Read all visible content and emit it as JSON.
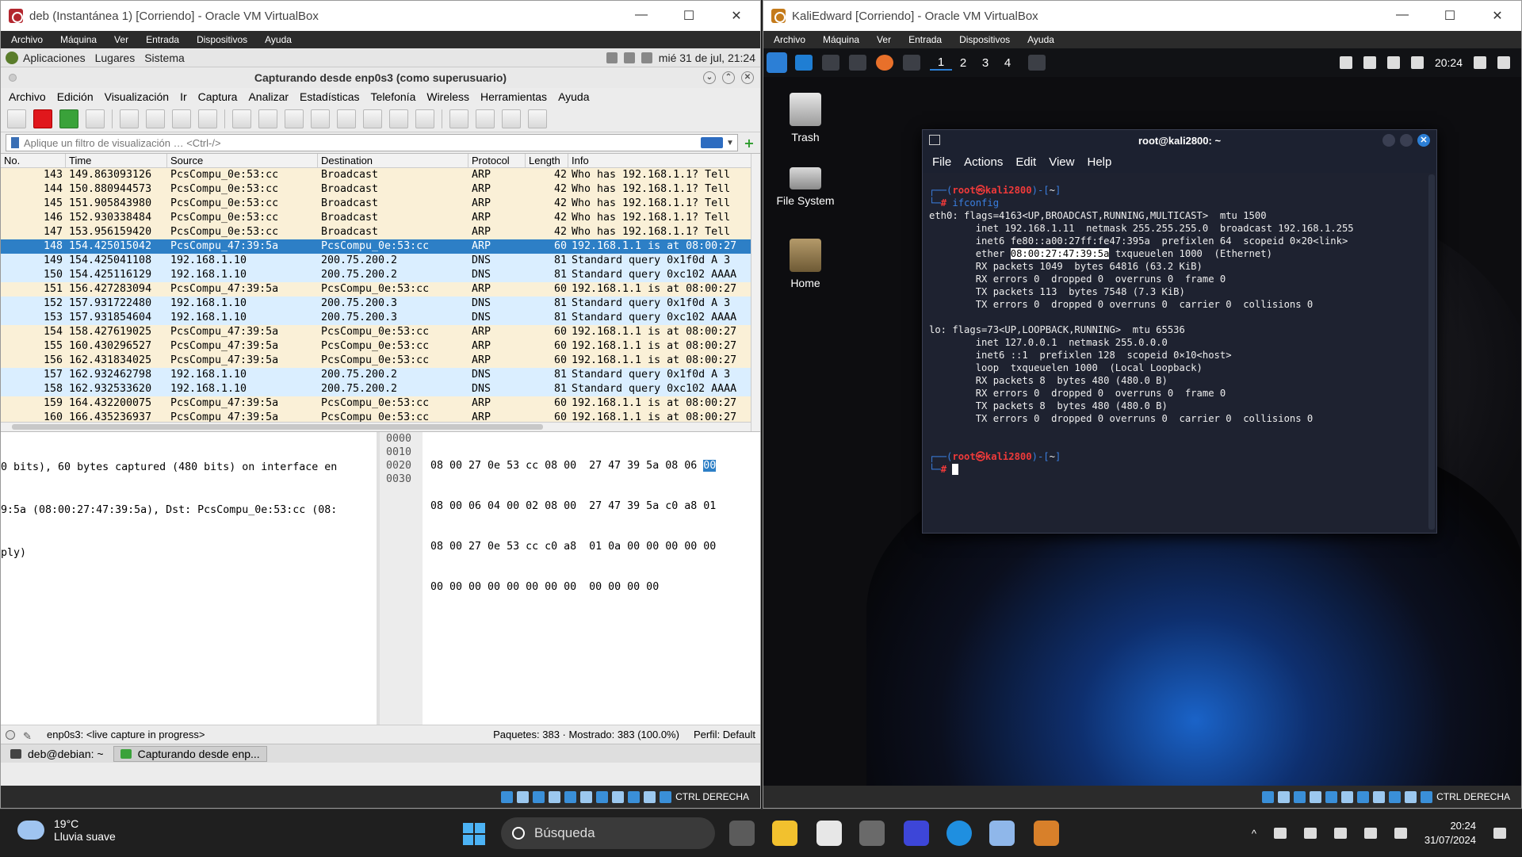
{
  "left_vm": {
    "title": "deb (Instantánea 1) [Corriendo] - Oracle VM VirtualBox",
    "menu": [
      "Archivo",
      "Máquina",
      "Ver",
      "Entrada",
      "Dispositivos",
      "Ayuda"
    ],
    "host_key": "CTRL DERECHA",
    "guest_panel": {
      "apps": "Aplicaciones",
      "places": "Lugares",
      "system": "Sistema",
      "clock": "mié 31 de jul, 21:24"
    },
    "wireshark": {
      "title": "Capturando desde enp0s3 (como superusuario)",
      "menu": [
        "Archivo",
        "Edición",
        "Visualización",
        "Ir",
        "Captura",
        "Analizar",
        "Estadísticas",
        "Telefonía",
        "Wireless",
        "Herramientas",
        "Ayuda"
      ],
      "filter_placeholder": "Aplique un filtro de visualización … <Ctrl-/>",
      "columns": [
        "No.",
        "Time",
        "Source",
        "Destination",
        "Protocol",
        "Length",
        "Info"
      ],
      "packets": [
        {
          "no": "143",
          "time": "149.863093126",
          "src": "PcsCompu_0e:53:cc",
          "dst": "Broadcast",
          "proto": "ARP",
          "len": "42",
          "info": "Who has 192.168.1.1? Tell",
          "kind": "arp"
        },
        {
          "no": "144",
          "time": "150.880944573",
          "src": "PcsCompu_0e:53:cc",
          "dst": "Broadcast",
          "proto": "ARP",
          "len": "42",
          "info": "Who has 192.168.1.1? Tell",
          "kind": "arp"
        },
        {
          "no": "145",
          "time": "151.905843980",
          "src": "PcsCompu_0e:53:cc",
          "dst": "Broadcast",
          "proto": "ARP",
          "len": "42",
          "info": "Who has 192.168.1.1? Tell",
          "kind": "arp"
        },
        {
          "no": "146",
          "time": "152.930338484",
          "src": "PcsCompu_0e:53:cc",
          "dst": "Broadcast",
          "proto": "ARP",
          "len": "42",
          "info": "Who has 192.168.1.1? Tell",
          "kind": "arp"
        },
        {
          "no": "147",
          "time": "153.956159420",
          "src": "PcsCompu_0e:53:cc",
          "dst": "Broadcast",
          "proto": "ARP",
          "len": "42",
          "info": "Who has 192.168.1.1? Tell",
          "kind": "arp"
        },
        {
          "no": "148",
          "time": "154.425015042",
          "src": "PcsCompu_47:39:5a",
          "dst": "PcsCompu_0e:53:cc",
          "proto": "ARP",
          "len": "60",
          "info": "192.168.1.1 is at 08:00:27",
          "kind": "sel"
        },
        {
          "no": "149",
          "time": "154.425041108",
          "src": "192.168.1.10",
          "dst": "200.75.200.2",
          "proto": "DNS",
          "len": "81",
          "info": "Standard query 0x1f0d A 3",
          "kind": "dns"
        },
        {
          "no": "150",
          "time": "154.425116129",
          "src": "192.168.1.10",
          "dst": "200.75.200.2",
          "proto": "DNS",
          "len": "81",
          "info": "Standard query 0xc102 AAAA",
          "kind": "dns"
        },
        {
          "no": "151",
          "time": "156.427283094",
          "src": "PcsCompu_47:39:5a",
          "dst": "PcsCompu_0e:53:cc",
          "proto": "ARP",
          "len": "60",
          "info": "192.168.1.1 is at 08:00:27",
          "kind": "arp"
        },
        {
          "no": "152",
          "time": "157.931722480",
          "src": "192.168.1.10",
          "dst": "200.75.200.3",
          "proto": "DNS",
          "len": "81",
          "info": "Standard query 0x1f0d A 3",
          "kind": "dns"
        },
        {
          "no": "153",
          "time": "157.931854604",
          "src": "192.168.1.10",
          "dst": "200.75.200.3",
          "proto": "DNS",
          "len": "81",
          "info": "Standard query 0xc102 AAAA",
          "kind": "dns"
        },
        {
          "no": "154",
          "time": "158.427619025",
          "src": "PcsCompu_47:39:5a",
          "dst": "PcsCompu_0e:53:cc",
          "proto": "ARP",
          "len": "60",
          "info": "192.168.1.1 is at 08:00:27",
          "kind": "arp"
        },
        {
          "no": "155",
          "time": "160.430296527",
          "src": "PcsCompu_47:39:5a",
          "dst": "PcsCompu_0e:53:cc",
          "proto": "ARP",
          "len": "60",
          "info": "192.168.1.1 is at 08:00:27",
          "kind": "arp"
        },
        {
          "no": "156",
          "time": "162.431834025",
          "src": "PcsCompu_47:39:5a",
          "dst": "PcsCompu_0e:53:cc",
          "proto": "ARP",
          "len": "60",
          "info": "192.168.1.1 is at 08:00:27",
          "kind": "arp"
        },
        {
          "no": "157",
          "time": "162.932462798",
          "src": "192.168.1.10",
          "dst": "200.75.200.2",
          "proto": "DNS",
          "len": "81",
          "info": "Standard query 0x1f0d A 3",
          "kind": "dns"
        },
        {
          "no": "158",
          "time": "162.932533620",
          "src": "192.168.1.10",
          "dst": "200.75.200.2",
          "proto": "DNS",
          "len": "81",
          "info": "Standard query 0xc102 AAAA",
          "kind": "dns"
        },
        {
          "no": "159",
          "time": "164.432200075",
          "src": "PcsCompu_47:39:5a",
          "dst": "PcsCompu_0e:53:cc",
          "proto": "ARP",
          "len": "60",
          "info": "192.168.1.1 is at 08:00:27",
          "kind": "arp"
        },
        {
          "no": "160",
          "time": "166.435236937",
          "src": "PcsCompu_47:39:5a",
          "dst": "PcsCompu_0e:53:cc",
          "proto": "ARP",
          "len": "60",
          "info": "192.168.1.1 is at 08:00:27",
          "kind": "arp"
        }
      ],
      "details": [
        "0 bits), 60 bytes captured (480 bits) on interface en",
        "9:5a (08:00:27:47:39:5a), Dst: PcsCompu_0e:53:cc (08:",
        "ply)"
      ],
      "bytes": [
        {
          "off": "0000",
          "hex": "08 00 27 0e 53 cc 08 00  27 47 39 5a 08 06 ",
          "hl": "00"
        },
        {
          "off": "0010",
          "hex": "08 00 06 04 00 02 08 00  27 47 39 5a c0 a8 01",
          "hl": ""
        },
        {
          "off": "0020",
          "hex": "08 00 27 0e 53 cc c0 a8  01 0a 00 00 00 00 00",
          "hl": ""
        },
        {
          "off": "0030",
          "hex": "00 00 00 00 00 00 00 00  00 00 00 00",
          "hl": ""
        }
      ],
      "status_iface": "enp0s3: <live capture in progress>",
      "status_packets": "Paquetes: 383 · Mostrado: 383 (100.0%)",
      "status_profile": "Perfil: Default"
    },
    "guest_taskbar": [
      "deb@debian: ~",
      "Capturando desde enp..."
    ]
  },
  "right_vm": {
    "title": "KaliEdward [Corriendo] - Oracle VM VirtualBox",
    "menu": [
      "Archivo",
      "Máquina",
      "Ver",
      "Entrada",
      "Dispositivos",
      "Ayuda"
    ],
    "host_key": "CTRL DERECHA",
    "workspaces": [
      "1",
      "2",
      "3",
      "4"
    ],
    "panel_clock": "20:24",
    "desktop_icons": [
      "Trash",
      "File System",
      "Home"
    ],
    "terminal": {
      "title": "root@kali2800: ~",
      "menu": [
        "File",
        "Actions",
        "Edit",
        "View",
        "Help"
      ],
      "prompt_user": "root㉿kali2800",
      "prompt_dir": "~",
      "command": "ifconfig",
      "output": [
        "eth0: flags=4163<UP,BROADCAST,RUNNING,MULTICAST>  mtu 1500",
        "        inet 192.168.1.11  netmask 255.255.255.0  broadcast 192.168.1.255",
        "        inet6 fe80::a00:27ff:fe47:395a  prefixlen 64  scopeid 0×20<link>",
        "        ether ",
        "        RX packets 1049  bytes 64816 (63.2 KiB)",
        "        RX errors 0  dropped 0  overruns 0  frame 0",
        "        TX packets 113  bytes 7548 (7.3 KiB)",
        "        TX errors 0  dropped 0 overruns 0  carrier 0  collisions 0",
        "",
        "lo: flags=73<UP,LOOPBACK,RUNNING>  mtu 65536",
        "        inet 127.0.0.1  netmask 255.0.0.0",
        "        inet6 ::1  prefixlen 128  scopeid 0×10<host>",
        "        loop  txqueuelen 1000  (Local Loopback)",
        "        RX packets 8  bytes 480 (480.0 B)",
        "        RX errors 0  dropped 0  overruns 0  frame 0",
        "        TX packets 8  bytes 480 (480.0 B)",
        "        TX errors 0  dropped 0 overruns 0  carrier 0  collisions 0"
      ],
      "ether_mac": "08:00:27:47:39:5a",
      "ether_rest": " txqueuelen 1000  (Ethernet)"
    }
  },
  "host_taskbar": {
    "temperature": "19°C",
    "weather": "Lluvia suave",
    "search_placeholder": "Búsqueda",
    "time": "20:24",
    "date": "31/07/2024"
  },
  "colors": {
    "arp_row": "#faf0d7",
    "dns_row": "#daeeff",
    "selected_row": "#2d7fc6",
    "kali_prompt_red": "#f03a3a",
    "kali_prompt_blue": "#3a7fe0"
  }
}
